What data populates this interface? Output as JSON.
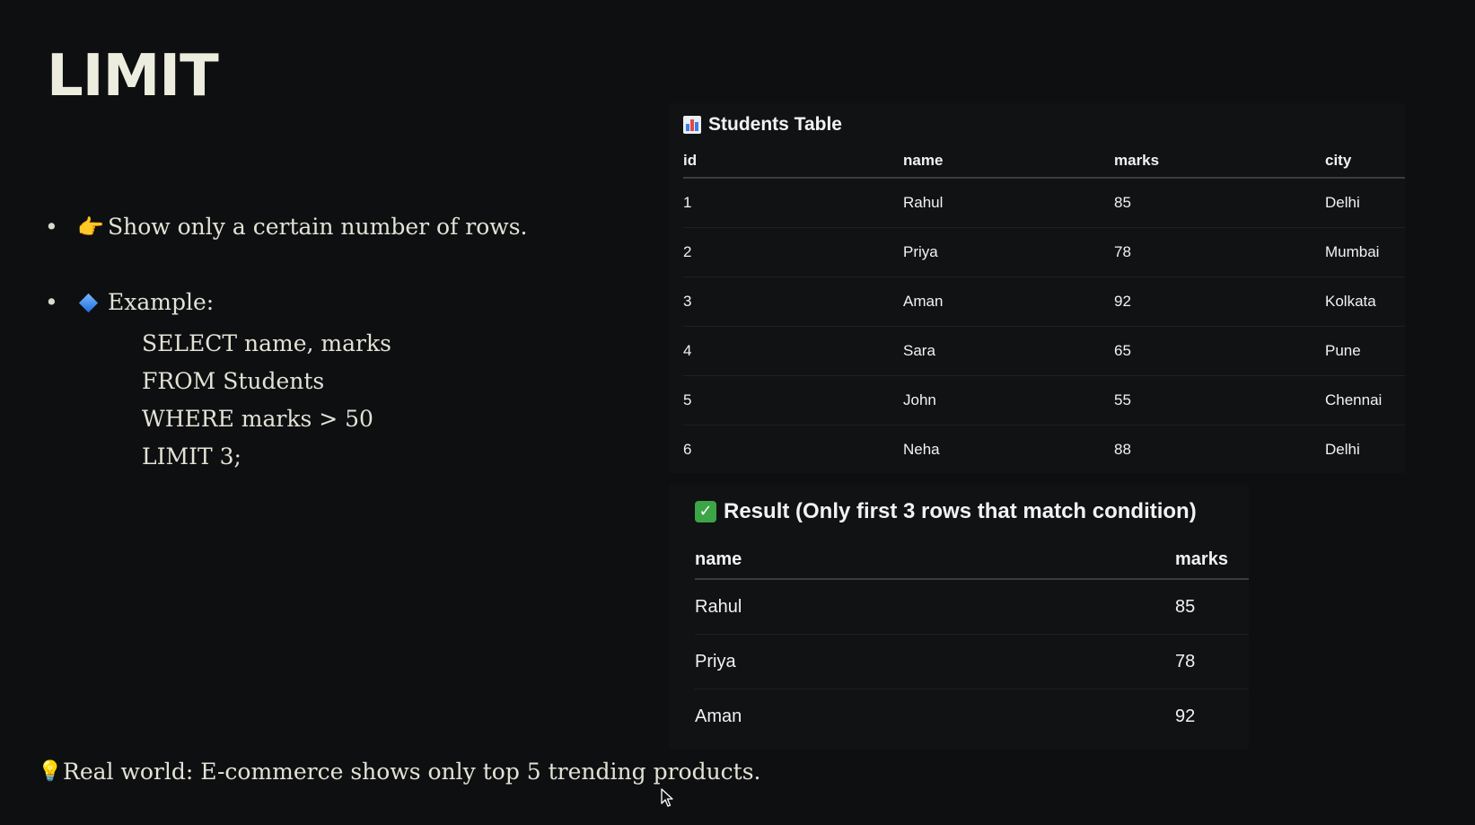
{
  "slide": {
    "title": "LIMIT"
  },
  "bullets": [
    {
      "emoji": "👉",
      "text": "Show only a certain number of rows."
    },
    {
      "emoji": "🔷",
      "text": "Example:"
    }
  ],
  "code_lines": [
    "SELECT name, marks",
    "FROM Students",
    "WHERE marks > 50",
    "LIMIT 3;"
  ],
  "real_world": {
    "emoji": "💡",
    "text": "Real world: E-commerce shows only top 5 trending products."
  },
  "students_table": {
    "icon": "bar-chart-icon",
    "title": "Students Table",
    "headers": [
      "id",
      "name",
      "marks",
      "city"
    ],
    "rows": [
      [
        "1",
        "Rahul",
        "85",
        "Delhi"
      ],
      [
        "2",
        "Priya",
        "78",
        "Mumbai"
      ],
      [
        "3",
        "Aman",
        "92",
        "Kolkata"
      ],
      [
        "4",
        "Sara",
        "65",
        "Pune"
      ],
      [
        "5",
        "John",
        "55",
        "Chennai"
      ],
      [
        "6",
        "Neha",
        "88",
        "Delhi"
      ]
    ]
  },
  "result_table": {
    "icon": "check-mark-icon",
    "title": "Result (Only first 3 rows that match condition)",
    "headers": [
      "name",
      "marks"
    ],
    "rows": [
      [
        "Rahul",
        "85"
      ],
      [
        "Priya",
        "78"
      ],
      [
        "Aman",
        "92"
      ]
    ]
  },
  "colors": {
    "background": "#0e0f11",
    "text": "#e3e2d6",
    "check_green": "#3ca545"
  }
}
